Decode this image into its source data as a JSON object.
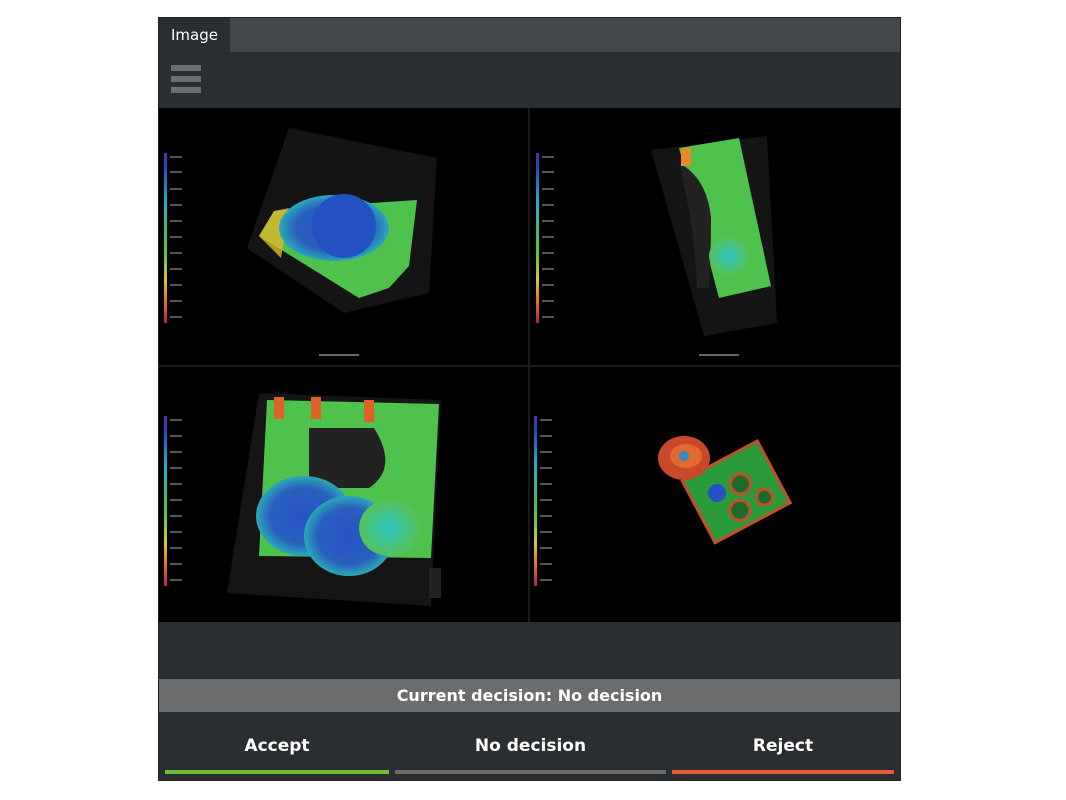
{
  "tab": {
    "label": "Image"
  },
  "toolbar": {
    "menu_icon": "hamburger-menu-icon"
  },
  "decision": {
    "current_text": "Current decision: No decision"
  },
  "buttons": {
    "accept": {
      "label": "Accept",
      "color": "#6cbf3e"
    },
    "no_decision": {
      "label": "No decision",
      "color": "#6a6c6e"
    },
    "reject": {
      "label": "Reject",
      "color": "#e45c35"
    }
  },
  "colors": {
    "panel_bg": "#2b2e30",
    "tabbar_bg": "#45484b",
    "decision_bar_bg": "#6a6c6e",
    "viewer_bg": "#000000"
  }
}
